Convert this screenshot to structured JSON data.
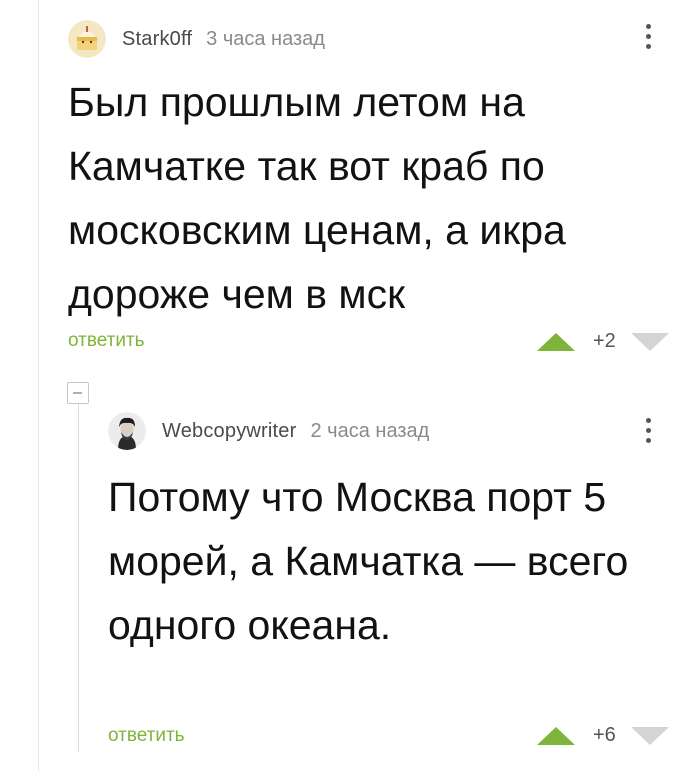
{
  "comments": [
    {
      "username": "Stark0ff",
      "time": "3 часа назад",
      "text": "Был прошлым летом на Камчатке так вот краб по московским ценам, а икра дороже чем в мск",
      "reply_label": "ответить",
      "score": "+2",
      "avatar_icon": "cake-avatar-icon"
    },
    {
      "username": "Webcopywriter",
      "time": "2 часа назад",
      "text": "Потому что Москва порт 5 морей, а Камчатка — всего одного океана.",
      "reply_label": "ответить",
      "score": "+6",
      "avatar_icon": "portrait-avatar-icon"
    }
  ],
  "colors": {
    "accent_green": "#7fb43b",
    "downvote_gray": "#d4d4d4"
  }
}
